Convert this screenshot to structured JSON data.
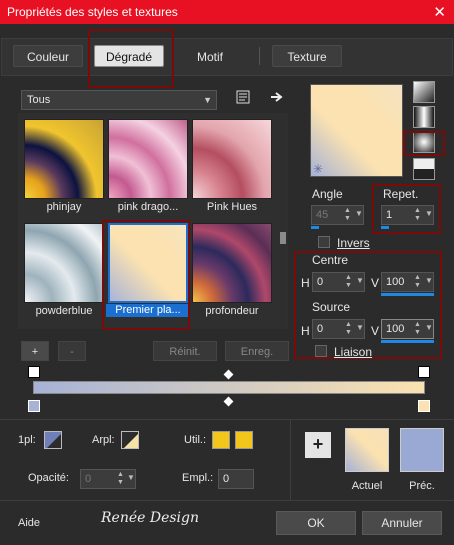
{
  "window": {
    "title": "Propriétés des styles et textures",
    "close_glyph": "✕"
  },
  "tabs": [
    {
      "label": "Couleur"
    },
    {
      "label": "Dégradé"
    },
    {
      "label": "Motif"
    },
    {
      "label": "Texture"
    }
  ],
  "library": {
    "dropdown_value": "Tous",
    "thumbnails": [
      {
        "label": "phinjay"
      },
      {
        "label": "pink drago..."
      },
      {
        "label": "Pink Hues"
      },
      {
        "label": "powderblue"
      },
      {
        "label": "Premier pla..."
      },
      {
        "label": "profondeur"
      }
    ],
    "add_label": "+",
    "remove_label": "-",
    "reset_label": "Réinit.",
    "save_label": "Enreg."
  },
  "gradient_settings": {
    "angle_label": "Angle",
    "angle_value": "45",
    "repeat_label": "Repet.",
    "repeat_value": "1",
    "invert_label": "Invers",
    "center_label": "Centre",
    "center_h_label": "H",
    "center_h": "0",
    "center_v_label": "V",
    "center_v": "100",
    "source_label": "Source",
    "source_h_label": "H",
    "source_h": "0",
    "source_v_label": "V",
    "source_v": "100",
    "link_label": "Liaison"
  },
  "bottom": {
    "first_plan_label": "1pl:",
    "back_plan_label": "Arpl:",
    "util_label": "Util.:",
    "opacity_label": "Opacité:",
    "opacity_value": "0",
    "placement_label": "Empl.:",
    "placement_value": "0",
    "current_label": "Actuel",
    "previous_label": "Préc.",
    "add_glyph": "+"
  },
  "footer": {
    "help_label": "Aide",
    "watermark": "Renée Design",
    "ok_label": "OK",
    "cancel_label": "Annuler"
  },
  "colors": {
    "accent_red": "#e81123",
    "selection_blue": "#1a6fd0",
    "gradient_cream": "#fbe2b0",
    "gradient_blue": "#a6b2d6",
    "swatch_yellow": "#f3c61c",
    "prev_blue": "#9aa8d4"
  },
  "icons": [
    "close-icon",
    "properties-icon",
    "arrow-right-icon",
    "plus-icon"
  ]
}
